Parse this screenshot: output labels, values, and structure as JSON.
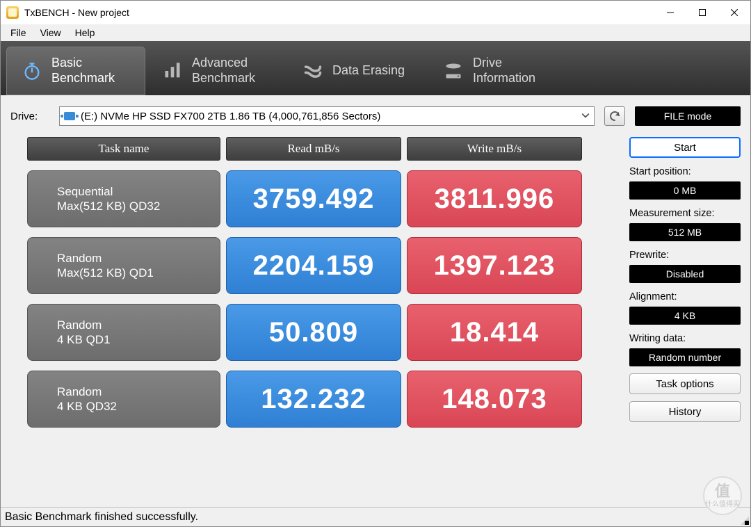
{
  "window": {
    "title": "TxBENCH - New project"
  },
  "menu": {
    "file": "File",
    "view": "View",
    "help": "Help"
  },
  "tabs": {
    "basic1": "Basic",
    "basic2": "Benchmark",
    "adv1": "Advanced",
    "adv2": "Benchmark",
    "erase": "Data Erasing",
    "drive1": "Drive",
    "drive2": "Information"
  },
  "drive": {
    "label": "Drive:",
    "selected": "(E:) NVMe HP SSD FX700 2TB  1.86 TB (4,000,761,856 Sectors)"
  },
  "buttons": {
    "file_mode": "FILE mode",
    "start": "Start",
    "task_options": "Task options",
    "history": "History"
  },
  "headers": {
    "task": "Task name",
    "read": "Read mB/s",
    "write": "Write mB/s"
  },
  "rows": [
    {
      "name1": "Sequential",
      "name2": "Max(512 KB) QD32",
      "read": "3759.492",
      "write": "3811.996"
    },
    {
      "name1": "Random",
      "name2": "Max(512 KB) QD1",
      "read": "2204.159",
      "write": "1397.123"
    },
    {
      "name1": "Random",
      "name2": "4 KB QD1",
      "read": "50.809",
      "write": "18.414"
    },
    {
      "name1": "Random",
      "name2": "4 KB QD32",
      "read": "132.232",
      "write": "148.073"
    }
  ],
  "sidebar": {
    "start_pos_label": "Start position:",
    "start_pos": "0 MB",
    "meas_size_label": "Measurement size:",
    "meas_size": "512 MB",
    "prewrite_label": "Prewrite:",
    "prewrite": "Disabled",
    "alignment_label": "Alignment:",
    "alignment": "4 KB",
    "writing_label": "Writing data:",
    "writing": "Random number"
  },
  "status": "Basic Benchmark finished successfully.",
  "watermark": {
    "top": "值",
    "bottom": "什么值得买"
  },
  "chart_data": {
    "type": "table",
    "columns": [
      "Task name",
      "Read mB/s",
      "Write mB/s"
    ],
    "rows": [
      [
        "Sequential Max(512 KB) QD32",
        3759.492,
        3811.996
      ],
      [
        "Random Max(512 KB) QD1",
        2204.159,
        1397.123
      ],
      [
        "Random 4 KB QD1",
        50.809,
        18.414
      ],
      [
        "Random 4 KB QD32",
        132.232,
        148.073
      ]
    ],
    "title": "TxBENCH Basic Benchmark"
  }
}
